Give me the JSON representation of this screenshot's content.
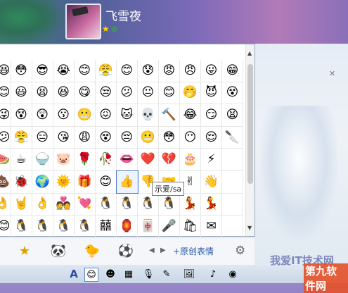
{
  "user": {
    "name": "飞雪夜"
  },
  "emoji_grid": [
    [
      "😆",
      "😳",
      "😎",
      "😭",
      "😊",
      "😤",
      "😊",
      "😰",
      "😡",
      "😠",
      "😛",
      "😁"
    ],
    [
      "😊",
      "😃",
      "😫",
      "😆",
      "😋",
      "😒",
      "😕",
      "😐",
      "😊",
      "🤭",
      "😈",
      "😵"
    ],
    [
      "😜",
      "😵",
      "😲",
      "😗",
      "😬",
      "😖",
      "🐱",
      "💀",
      "🔨",
      "😂",
      "😏",
      "😫"
    ],
    [
      "😕",
      "😤",
      "😑",
      "😘",
      "😩",
      "😵",
      "😔",
      "😬",
      "😳",
      "😶",
      "😌",
      "🔪"
    ],
    [
      "🍉",
      "☕",
      "🍚",
      "🐷",
      "🌹",
      "🥀",
      "👄",
      "❤️",
      "💔",
      "🎂",
      "⚡",
      ""
    ],
    [
      "💩",
      "🐞",
      "🌍",
      "🌞",
      "🎁",
      "😊",
      "👍",
      "👎",
      "🤝",
      "✌",
      "👋",
      ""
    ],
    [
      "👌",
      "🤘",
      "👌",
      "💑",
      "💘",
      "🐧",
      "🐧",
      "🐧",
      "🐧",
      "💃",
      "💃",
      ""
    ],
    [
      "😊",
      "🐧",
      "🐧",
      "🐧",
      "🐧",
      "囍",
      "🏮",
      "🀄",
      "🎤",
      "🛍",
      "✉",
      ""
    ]
  ],
  "tooltip": "示爱/sa",
  "tabs": {
    "star": "★",
    "add_custom": "+原创表情",
    "prev": "◀",
    "next": "▶",
    "gear": "⚙"
  },
  "toolbar": {
    "font": "A",
    "smile": "😊",
    "watermark": "我爱IT技术网",
    "watermark2": "第九软件网"
  }
}
